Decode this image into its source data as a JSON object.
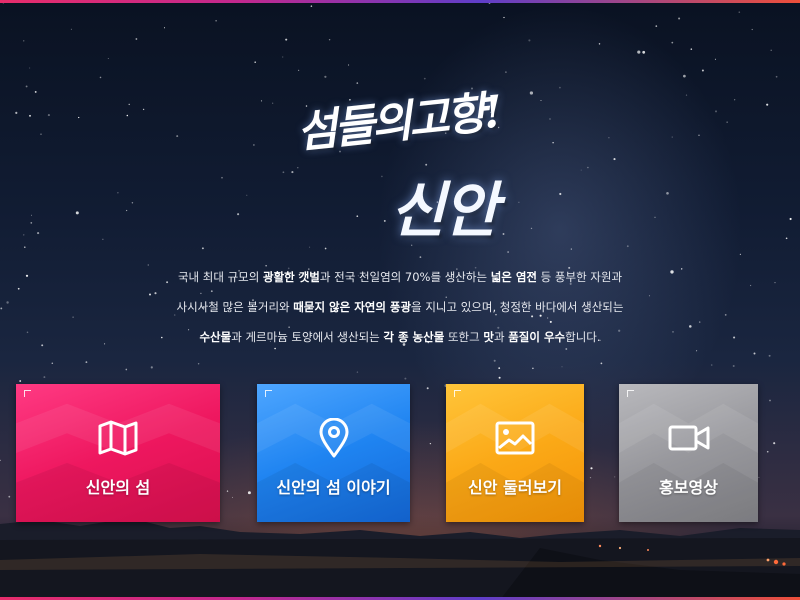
{
  "logo": {
    "line1": "섬들의고향!",
    "line2": "신안"
  },
  "intro": {
    "line1": [
      "국내 최대 규모의 ",
      "광활한 갯벌",
      "과 전국 천일염의 70%를 생산하는 ",
      "넓은 염전",
      " 등 풍부한 자원과"
    ],
    "line2": [
      "사시사철 많은 볼거리와 ",
      "때묻지 않은 자연의 풍광",
      "을 지니고 있으며, 청정한 바다에서 생산되는"
    ],
    "line3": [
      "수산물",
      "과 게르마늄 토양에서 생산되는 ",
      "각 종 농산물",
      " 또한그 ",
      "맛",
      "과 ",
      "품질이 우수",
      "합니다."
    ]
  },
  "tiles": [
    {
      "label": "신안의 섬",
      "icon": "map-icon",
      "color": "#ee175f"
    },
    {
      "label": "신안의 섬 이야기",
      "icon": "location-pin-icon",
      "color": "#1f84f1"
    },
    {
      "label": "신안 둘러보기",
      "icon": "image-icon",
      "color": "#fba917"
    },
    {
      "label": "홍보영상",
      "icon": "video-camera-icon",
      "color": "#98989d"
    }
  ],
  "colors": {
    "accent_pink": "#e72d6b",
    "accent_purple": "#5f3ec9",
    "accent_orange": "#ee4f3a",
    "background": "#0b1426"
  }
}
